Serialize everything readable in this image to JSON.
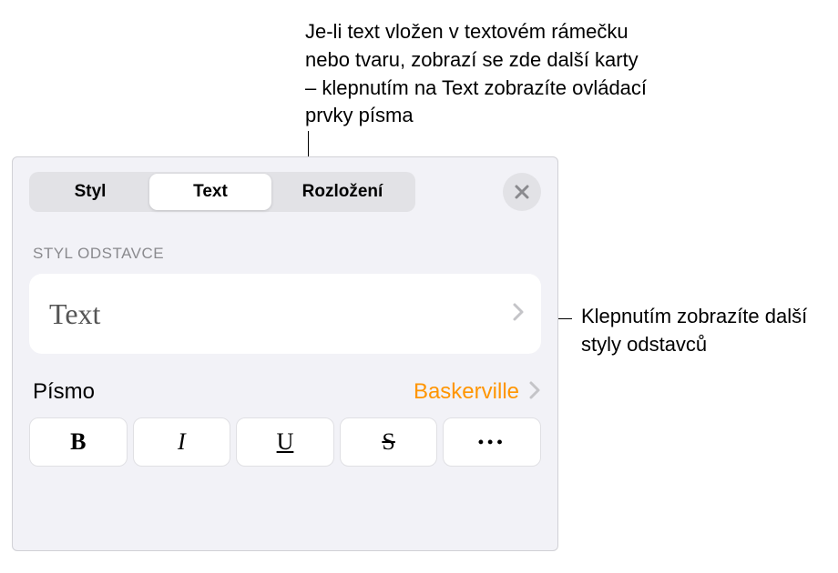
{
  "callouts": {
    "top": "Je-li text vložen v textovém rámečku nebo tvaru, zobrazí se zde další karty – klepnutím na Text zobrazíte ovládací prvky písma",
    "right": "Klepnutím zobrazíte další styly odstavců"
  },
  "tabs": {
    "styl": "Styl",
    "text": "Text",
    "rozlozeni": "Rozložení"
  },
  "section_paragraph_style_label": "STYL ODSTAVCE",
  "paragraph_style_value": "Text",
  "font": {
    "label": "Písmo",
    "value": "Baskerville"
  },
  "format_buttons": {
    "bold": "B",
    "italic": "I",
    "underline": "U",
    "strike": "S",
    "more": "•••"
  }
}
